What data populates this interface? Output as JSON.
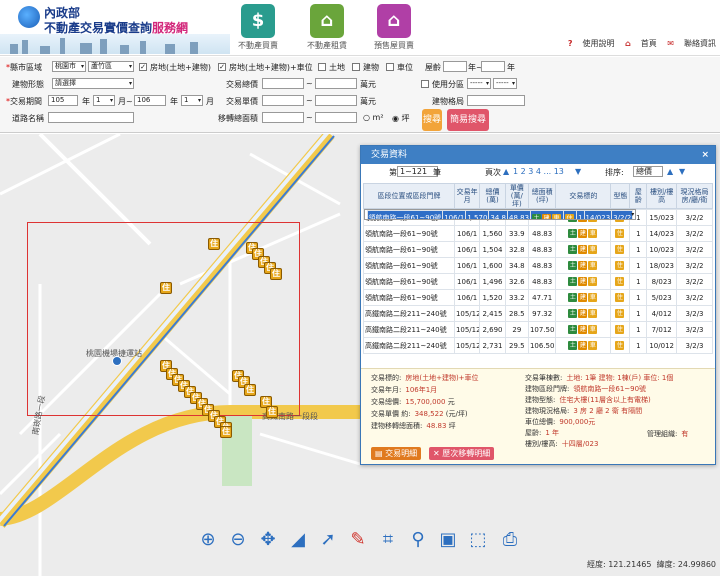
{
  "header": {
    "logo_line1": "內政部",
    "logo_line2_a": "不動產交易實價查詢",
    "logo_line2_b": "服務網",
    "tabs": [
      {
        "label": "不動產買賣",
        "color": "#2a9c8e"
      },
      {
        "label": "不動產租賃",
        "color": "#6aa53b"
      },
      {
        "label": "預售屋買賣",
        "color": "#b03fa6"
      }
    ],
    "links": {
      "help": "使用說明",
      "home": "首頁",
      "contact": "聯絡資訊"
    }
  },
  "form": {
    "city_label": "縣市區域",
    "city_value": "桃園市",
    "district_value": "蘆竹區",
    "type_options": [
      {
        "label": "房地(土地+建物)",
        "checked": true
      },
      {
        "label": "房地(土地+建物)+車位",
        "checked": true
      },
      {
        "label": "土地",
        "checked": false
      },
      {
        "label": "建物",
        "checked": false
      },
      {
        "label": "車位",
        "checked": false
      }
    ],
    "age_label": "屋齡",
    "age_sep": "年~",
    "age_unit": "年",
    "building_type_label": "建物形態",
    "building_type_value": "請選擇",
    "total_price_label": "交易總價",
    "price_sep": "~",
    "price_unit": "萬元",
    "use_zone_label": "使用分區",
    "use_zone_a": "-----",
    "use_zone_b": "-----",
    "period_label": "交易期間",
    "period_from_year": "105",
    "period_year_unit": "年",
    "period_from_month": "1",
    "period_month_unit": "月~",
    "period_to_year": "106",
    "period_to_month": "1",
    "period_month_unit2": "月",
    "unit_price_label": "交易單價",
    "building_layout_label": "建物格局",
    "road_label": "道路名稱",
    "area_label": "移轉總面積",
    "area_unit_m2": "m²",
    "area_unit_ping": "坪",
    "search_btn": "搜尋",
    "advanced_btn": "簡易搜尋"
  },
  "map": {
    "station_label": "桃園機場捷運站",
    "road_label_1": "南崁路一段",
    "road_label_2": "高鐵南路一段",
    "road_label_3": "段",
    "pin_glyph": "住",
    "coords_lon_label": "經度:",
    "coords_lon": "121.21465",
    "coords_lat_label": "緯度:",
    "coords_lat": "24.99860"
  },
  "panel": {
    "title": "交易資料",
    "close": "×",
    "page_prefix": "第",
    "page_range": "1~121",
    "page_suffix": "筆",
    "pages_label": "頁次",
    "pages": "1 2 3 4 ... 13",
    "sort_label": "排序:",
    "sort_value": "總價",
    "columns": [
      "區段位置或區段門牌",
      "交易年月",
      "總價(萬)",
      "單價(萬/坪)",
      "總面積(坪)",
      "交易標的",
      "型態",
      "屋齡",
      "樓別/樓高",
      "現況格局房/廳/衛"
    ],
    "rows": [
      {
        "addr": "領航南路一段61~90號",
        "date": "106/1",
        "total": "1,570",
        "unit": "34.8",
        "area": "48.83",
        "age": "1",
        "floor": "14/023",
        "layout": "3/2/2",
        "selected": true
      },
      {
        "addr": "領航南路一段61~90號",
        "date": "106/1",
        "total": "1,550",
        "unit": "33.9",
        "area": "48.83",
        "age": "1",
        "floor": "15/023",
        "layout": "3/2/2",
        "selected": false
      },
      {
        "addr": "領航南路一段61~90號",
        "date": "106/1",
        "total": "1,560",
        "unit": "33.9",
        "area": "48.83",
        "age": "1",
        "floor": "14/023",
        "layout": "3/2/2",
        "selected": false
      },
      {
        "addr": "領航南路一段61~90號",
        "date": "106/1",
        "total": "1,504",
        "unit": "32.8",
        "area": "48.83",
        "age": "1",
        "floor": "10/023",
        "layout": "3/2/2",
        "selected": false
      },
      {
        "addr": "領航南路一段61~90號",
        "date": "106/1",
        "total": "1,600",
        "unit": "34.8",
        "area": "48.83",
        "age": "1",
        "floor": "18/023",
        "layout": "3/2/2",
        "selected": false
      },
      {
        "addr": "領航南路一段61~90號",
        "date": "106/1",
        "total": "1,496",
        "unit": "32.6",
        "area": "48.83",
        "age": "1",
        "floor": "8/023",
        "layout": "3/2/2",
        "selected": false
      },
      {
        "addr": "領航南路一段61~90號",
        "date": "106/1",
        "total": "1,520",
        "unit": "33.2",
        "area": "47.71",
        "age": "1",
        "floor": "5/023",
        "layout": "3/2/2",
        "selected": false
      },
      {
        "addr": "高鐵南路二段211~240號",
        "date": "105/12",
        "total": "2,415",
        "unit": "28.5",
        "area": "97.32",
        "age": "1",
        "floor": "4/012",
        "layout": "3/2/3",
        "selected": false
      },
      {
        "addr": "高鐵南路二段211~240號",
        "date": "105/12",
        "total": "2,690",
        "unit": "29",
        "area": "107.50",
        "age": "1",
        "floor": "7/012",
        "layout": "3/2/3",
        "selected": false
      },
      {
        "addr": "高鐵南路二段211~240號",
        "date": "105/12",
        "total": "2,731",
        "unit": "29.5",
        "area": "106.50",
        "age": "1",
        "floor": "10/012",
        "layout": "3/2/3",
        "selected": false
      }
    ],
    "tag_labels": {
      "land": "土",
      "building": "建",
      "car": "車",
      "type": "住"
    },
    "detail": {
      "left": [
        {
          "k": "交易標的:",
          "v": "房地(土地+建物)+車位"
        },
        {
          "k": "交易年月:",
          "v": "106年1月"
        },
        {
          "k": "交易總價:",
          "v": "15,700,000",
          "u": "元"
        },
        {
          "k": "交易單價 約:",
          "v": "348,522",
          "u": "(元/坪)"
        },
        {
          "k": "建物移轉總面積:",
          "v": "48.83",
          "u": "坪"
        }
      ],
      "right": [
        {
          "k": "交易筆棟數:",
          "v": "土地: 1筆 建物: 1棟(戶) 車位: 1個"
        },
        {
          "k": "建物區段門牌:",
          "v": "領航南路一段61~90號"
        },
        {
          "k": "建物型態:",
          "v": "住宅大樓(11層含以上有電梯)"
        },
        {
          "k": "建物現況格局:",
          "v": "3 房 2 廳 2 衛 有隔間"
        },
        {
          "k": "車位總價:",
          "v": "900,000元"
        },
        {
          "k": "屋齡:",
          "v": "1 年"
        },
        {
          "k": "樓別/樓高:",
          "v": "十四層/023"
        }
      ],
      "mgmt_label": "管理組織:",
      "mgmt_value": "有",
      "btn_detail": "交易明細",
      "btn_history": "歷次移轉明細"
    }
  },
  "toolbar": {
    "tools": [
      "zoom-in",
      "zoom-out",
      "pan",
      "measure-distance",
      "measure-area",
      "select-area",
      "clear",
      "locate",
      "full-extent",
      "previous-extent",
      "print"
    ]
  }
}
